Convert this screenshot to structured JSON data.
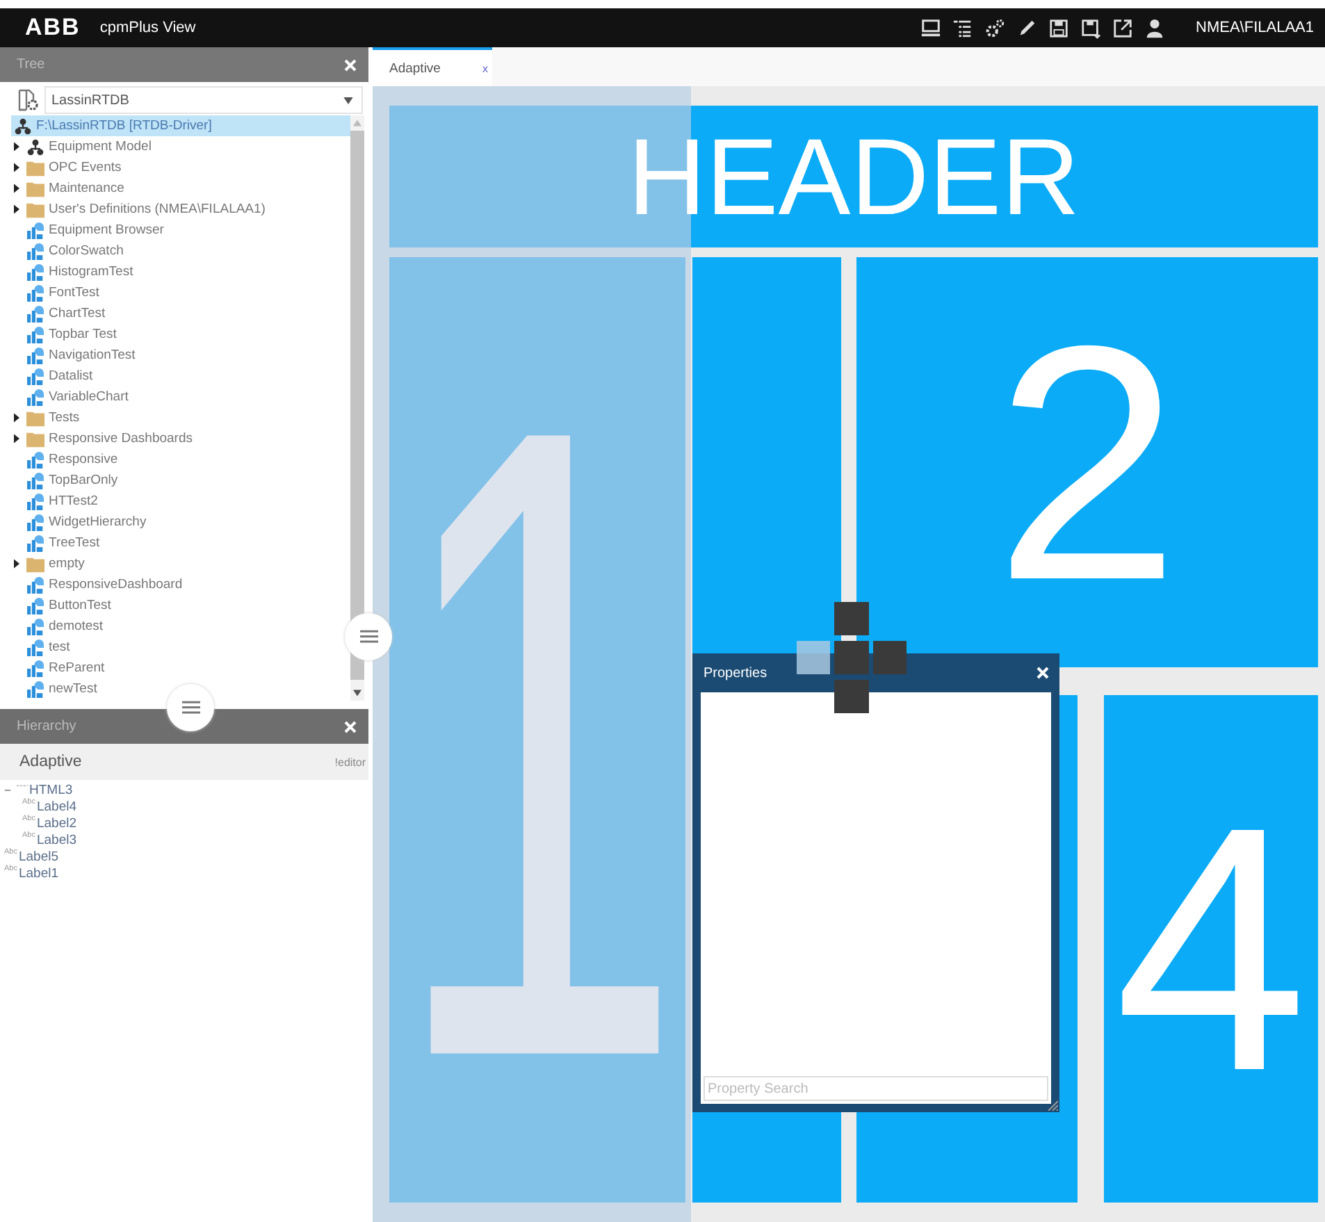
{
  "app": {
    "logo": "ABB",
    "title": "cpmPlus View",
    "user": "NMEA\\FILALAA1"
  },
  "tree_panel": {
    "title": "Tree",
    "source": "LassinRTDB",
    "items": [
      {
        "kind": "root",
        "label": "F:\\LassinRTDB [RTDB-Driver]",
        "selected": true
      },
      {
        "kind": "model",
        "label": "Equipment Model",
        "selected": false
      },
      {
        "kind": "folder",
        "label": "OPC Events",
        "selected": false
      },
      {
        "kind": "folder",
        "label": "Maintenance",
        "selected": false
      },
      {
        "kind": "folder",
        "label": "User's Definitions (NMEA\\FILALAA1)",
        "selected": false
      },
      {
        "kind": "display",
        "label": "Equipment Browser",
        "selected": false
      },
      {
        "kind": "display",
        "label": "ColorSwatch",
        "selected": false
      },
      {
        "kind": "display",
        "label": "HistogramTest",
        "selected": false
      },
      {
        "kind": "display",
        "label": "FontTest",
        "selected": false
      },
      {
        "kind": "display",
        "label": "ChartTest",
        "selected": false
      },
      {
        "kind": "display",
        "label": "Topbar Test",
        "selected": false
      },
      {
        "kind": "display",
        "label": "NavigationTest",
        "selected": false
      },
      {
        "kind": "display",
        "label": "Datalist",
        "selected": false
      },
      {
        "kind": "display",
        "label": "VariableChart",
        "selected": false
      },
      {
        "kind": "folder",
        "label": "Tests",
        "selected": false
      },
      {
        "kind": "folder",
        "label": "Responsive Dashboards",
        "selected": false
      },
      {
        "kind": "display",
        "label": "Responsive",
        "selected": false
      },
      {
        "kind": "display",
        "label": "TopBarOnly",
        "selected": false
      },
      {
        "kind": "display",
        "label": "HTTest2",
        "selected": false
      },
      {
        "kind": "display",
        "label": "WidgetHierarchy",
        "selected": false
      },
      {
        "kind": "display",
        "label": "TreeTest",
        "selected": false
      },
      {
        "kind": "folder",
        "label": "empty",
        "selected": false
      },
      {
        "kind": "display",
        "label": "ResponsiveDashboard",
        "selected": false
      },
      {
        "kind": "display",
        "label": "ButtonTest",
        "selected": false
      },
      {
        "kind": "display",
        "label": "demotest",
        "selected": false
      },
      {
        "kind": "display",
        "label": "test",
        "selected": false
      },
      {
        "kind": "display",
        "label": "ReParent",
        "selected": false
      },
      {
        "kind": "display",
        "label": "newTest",
        "selected": false
      }
    ]
  },
  "hierarchy_panel": {
    "title": "Hierarchy",
    "document": "Adaptive",
    "mode": "!editor",
    "items": [
      {
        "kind": "html",
        "label": "HTML3",
        "expanded": true,
        "children": [
          {
            "kind": "label",
            "badge": "Abc",
            "label": "Label4"
          },
          {
            "kind": "label",
            "badge": "Abc",
            "label": "Label2"
          },
          {
            "kind": "label",
            "badge": "Abc",
            "label": "Label3"
          }
        ]
      },
      {
        "kind": "label",
        "badge": "Abc",
        "label": "Label5"
      },
      {
        "kind": "label",
        "badge": "Abc",
        "label": "Label1"
      }
    ]
  },
  "tabs": [
    {
      "label": "Adaptive",
      "close": "x",
      "selected": true
    }
  ],
  "canvas": {
    "cells": [
      {
        "kind": "header",
        "label": "HEADER"
      },
      {
        "kind": "cell",
        "label": "1",
        "selected": true
      },
      {
        "kind": "cell"
      },
      {
        "kind": "cell",
        "label": "2"
      },
      {
        "kind": "cell"
      },
      {
        "kind": "cell",
        "label": "4"
      }
    ]
  },
  "properties_dialog": {
    "title": "Properties",
    "search": {
      "placeholder": "Property Search"
    }
  }
}
